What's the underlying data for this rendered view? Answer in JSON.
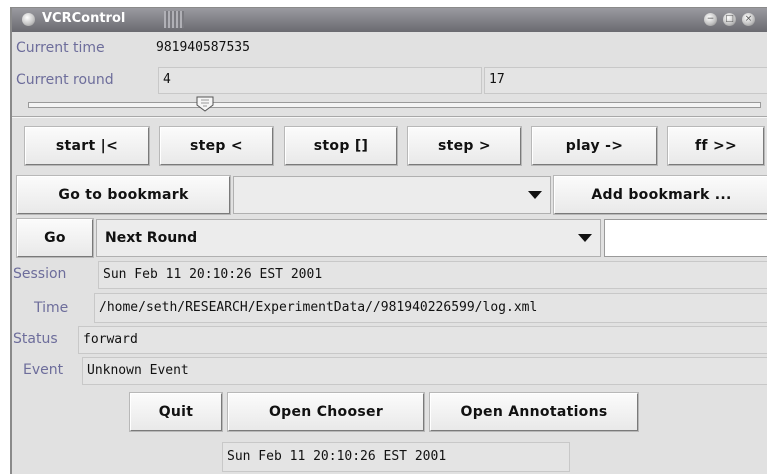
{
  "window": {
    "title": "VCRControl"
  },
  "current_time": {
    "label": "Current time",
    "value": "981940587535"
  },
  "current_round": {
    "label": "Current round",
    "value": "4",
    "total": "17"
  },
  "slider": {
    "value": 4,
    "max": 17
  },
  "transport": {
    "start": "start |<",
    "step_back": "step <",
    "stop": "stop []",
    "step_forward": "step >",
    "play": "play ->",
    "ff": "ff >>"
  },
  "bookmark": {
    "go_label": "Go to bookmark",
    "selected": "",
    "add_label": "Add bookmark ..."
  },
  "goto": {
    "go_label": "Go",
    "selected": "Next Round",
    "input_value": ""
  },
  "info": {
    "session_label": "Session",
    "session_value": "Sun Feb 11 20:10:26 EST 2001",
    "time_label": "Time",
    "time_value": "/home/seth/RESEARCH/ExperimentData//981940226599/log.xml",
    "status_label": "Status",
    "status_value": "forward",
    "event_label": "Event",
    "event_value": "Unknown Event"
  },
  "bottom": {
    "quit": "Quit",
    "open_chooser": "Open Chooser",
    "open_annotations": "Open Annotations"
  },
  "status_bar": {
    "value": "Sun Feb 11 20:10:26 EST 2001"
  }
}
